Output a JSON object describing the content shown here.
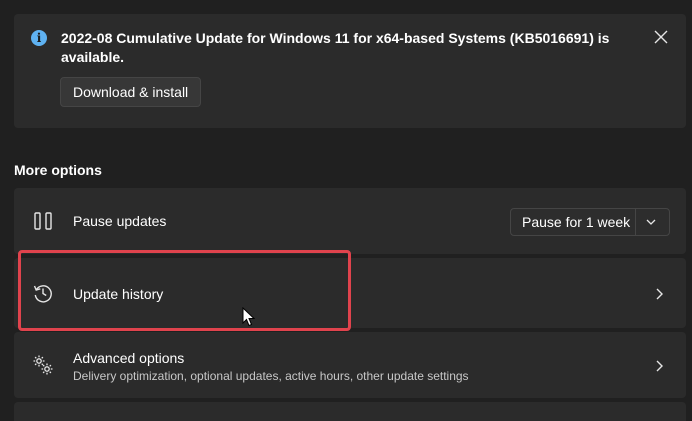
{
  "notification": {
    "title": "2022-08 Cumulative Update for Windows 11 for x64-based Systems (KB5016691) is available.",
    "download_label": "Download & install",
    "info_icon": "info-icon",
    "close_icon": "close-icon"
  },
  "more_options": {
    "title": "More options",
    "pause_updates": {
      "label": "Pause updates",
      "icon": "pause-icon",
      "dropdown_value": "Pause for 1 week"
    },
    "update_history": {
      "label": "Update history",
      "icon": "history-icon"
    },
    "advanced_options": {
      "label": "Advanced options",
      "description": "Delivery optimization, optional updates, active hours, other update settings",
      "icon": "gears-icon"
    }
  },
  "colors": {
    "background": "#202020",
    "card": "#2b2b2b",
    "accent_info": "#5fb2f2",
    "highlight": "#e0434d"
  }
}
